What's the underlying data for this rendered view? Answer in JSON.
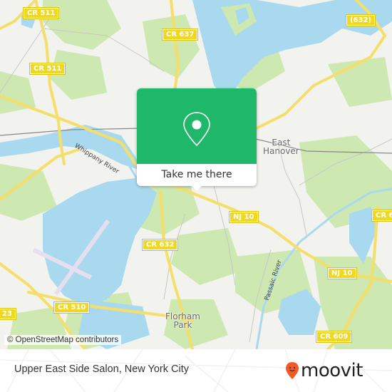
{
  "map": {
    "road_labels": [
      {
        "id": "cr511-top",
        "text": "CR 511"
      },
      {
        "id": "cr511-mid",
        "text": "CR 511"
      },
      {
        "id": "cr637",
        "text": "CR 637"
      },
      {
        "id": "cr632-top",
        "text": "(632)"
      },
      {
        "id": "cr632",
        "text": "CR 632"
      },
      {
        "id": "cr510",
        "text": "CR 510"
      },
      {
        "id": "nj10-a",
        "text": "NJ 10"
      },
      {
        "id": "nj10-b",
        "text": "NJ 10"
      },
      {
        "id": "cr6-right",
        "text": "CR 6"
      },
      {
        "id": "cr609",
        "text": "CR 609"
      },
      {
        "id": "rt23",
        "text": "23"
      }
    ],
    "places": [
      {
        "id": "east-hanover",
        "text": "East\nHanover"
      },
      {
        "id": "florham-park",
        "text": "Florham\nPark"
      }
    ],
    "rivers": [
      {
        "id": "whippany",
        "text": "Whippany River"
      },
      {
        "id": "passaic",
        "text": "Passaic River"
      }
    ],
    "colors": {
      "land": "#f2f2ee",
      "water": "#a9d9ef",
      "park": "#cde8b0",
      "road": "#f5df6a",
      "shield": "#f0d81e",
      "runway": "#e6dff0"
    },
    "attribution": "© OpenStreetMap contributors"
  },
  "popup": {
    "icon": "map-pin-icon",
    "button_label": "Take me there",
    "color": "#1fb86b"
  },
  "footer": {
    "title": "Upper East Side Salon, New York City",
    "brand": "moovit",
    "brand_color": "#f05a28"
  }
}
